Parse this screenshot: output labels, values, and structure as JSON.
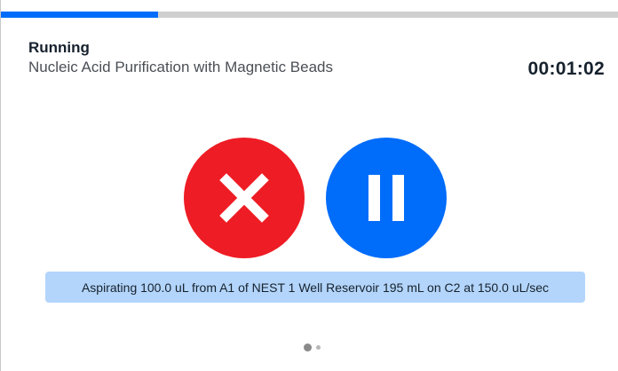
{
  "progress": {
    "fraction": 0.255
  },
  "header": {
    "status": "Running",
    "protocol_name": "Nucleic Acid Purification with Magnetic Beads",
    "elapsed_time": "00:01:02"
  },
  "controls": {
    "cancel_icon": "x-icon",
    "pause_icon": "pause-icon"
  },
  "current_command": "Aspirating 100.0 uL from A1 of NEST 1 Well Reservoir 195 mL on C2 at 150.0 uL/sec",
  "pager": {
    "page": 1,
    "total": 2
  },
  "colors": {
    "accent_blue": "#006cfa",
    "cancel_red": "#ee1c24",
    "banner_blue": "#b3d5fb",
    "text_dark": "#16212d"
  }
}
